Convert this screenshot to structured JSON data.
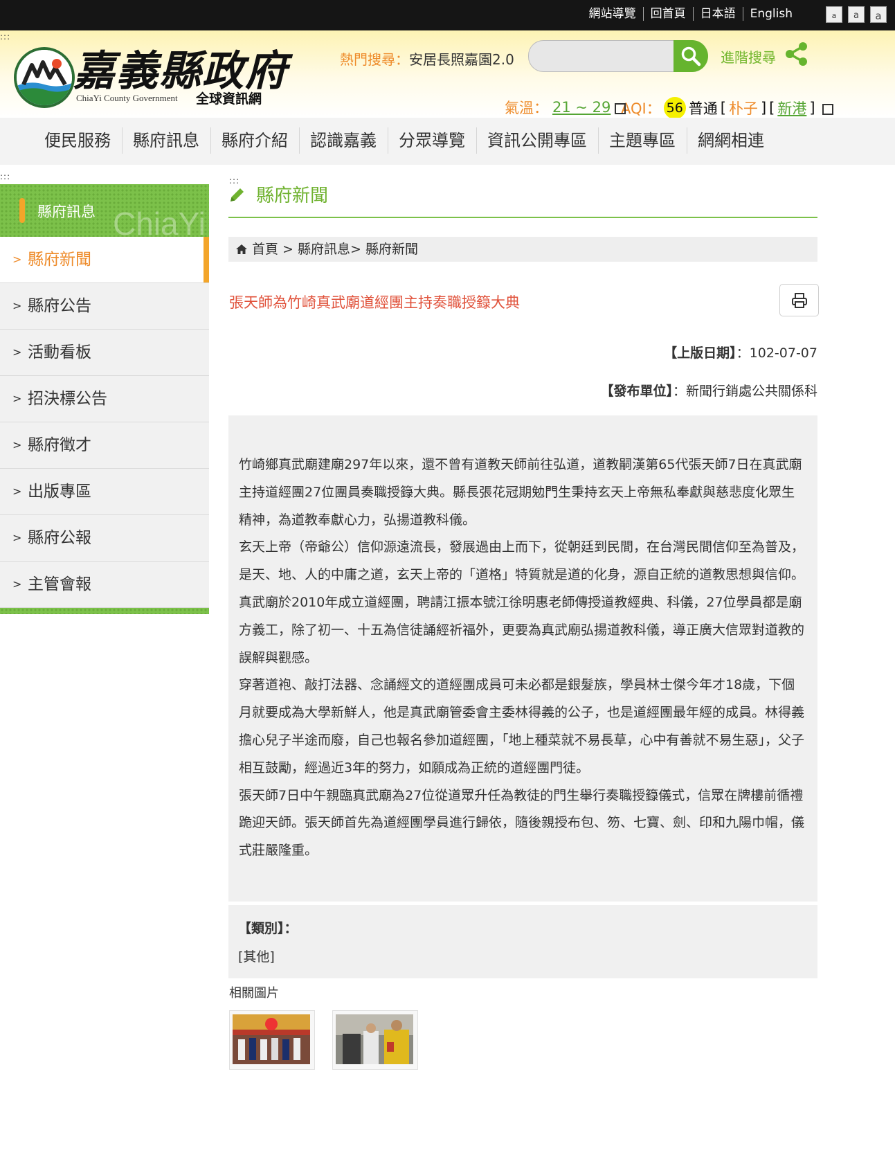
{
  "topbar": {
    "links": [
      "網站導覽",
      "回首頁",
      "日本語",
      "English"
    ],
    "font_sizes": [
      "a",
      "a",
      "a"
    ]
  },
  "header": {
    "logo_title": "嘉義縣政府",
    "logo_en": "ChiaYi County Government",
    "logo_sub": "全球資訊網",
    "hot_label": "熱門搜尋：",
    "hot_keyword": "安居長照嘉園2.0",
    "search_placeholder": "",
    "advanced_search": "進階搜尋",
    "weather_label": "氣溫：",
    "weather_value": "21 ~ 29",
    "aqi_label": "AQI：",
    "aqi_value": "56",
    "aqi_level": "普通",
    "aqi_station1": "朴子",
    "aqi_station2": "新港"
  },
  "nav": {
    "items": [
      "便民服務",
      "縣府訊息",
      "縣府介紹",
      "認識嘉義",
      "分眾導覽",
      "資訊公開專區",
      "主題專區",
      "網網相連"
    ]
  },
  "sidebar": {
    "heading": "縣府訊息",
    "watermark": "ChiaYi",
    "items": [
      "縣府新聞",
      "縣府公告",
      "活動看板",
      "招決標公告",
      "縣府徵才",
      "出版專區",
      "縣府公報",
      "主管會報"
    ],
    "active_index": 0
  },
  "page": {
    "title": "縣府新聞",
    "breadcrumb": "首頁 > 縣府訊息> 縣府新聞"
  },
  "article": {
    "title": "張天師為竹崎真武廟道經團主持奏職授籙大典",
    "date_label": "【上版日期】",
    "date_value": "：102-07-07",
    "unit_label": "【發布單位】",
    "unit_value": "：新聞行銷處公共關係科",
    "paragraphs": [
      "竹崎鄉真武廟建廟297年以來，還不曾有道教天師前往弘道，道教嗣漢第65代張天師7日在真武廟主持道經團27位團員奏職授籙大典。縣長張花冠期勉門生秉持玄天上帝無私奉獻與慈悲度化眾生精神，為道教奉獻心力，弘揚道教科儀。",
      "玄天上帝（帝爺公）信仰源遠流長，發展過由上而下，從朝廷到民間，在台灣民間信仰至為普及，是天、地、人的中庸之道，玄天上帝的「道格」特質就是道的化身，源自正統的道教思想與信仰。",
      "真武廟於2010年成立道經團，聘請江振本號江徐明惠老師傳授道教經典、科儀，27位學員都是廟方義工，除了初一、十五為信徒誦經祈福外，更要為真武廟弘揚道教科儀，導正廣大信眾對道教的誤解與觀感。",
      "穿著道袍、敲打法器、念誦經文的道經團成員可未必都是銀髮族，學員林士傑今年才18歲，下個月就要成為大學新鮮人，他是真武廟管委會主委林得義的公子，也是道經團最年經的成員。林得義擔心兒子半途而廢，自己也報名參加道經團，「地上種菜就不易長草，心中有善就不易生惡」，父子相互鼓勵，經過近3年的努力，如願成為正統的道經團門徒。",
      "張天師7日中午親臨真武廟為27位從道眾升任為教徒的門生舉行奏職授籙儀式，信眾在牌樓前循禮跪迎天師。張天師首先為道經團學員進行歸依，隨後親授布包、笏、七寶、劍、印和九陽巾帽，儀式莊嚴隆重。"
    ],
    "category_label": "【類別】：",
    "category_value": "[其他]",
    "related_label": "相關圖片"
  },
  "colors": {
    "green": "#7cc14a",
    "orange": "#f3a52a",
    "title_red": "#e0513a",
    "topbar": "#151515"
  }
}
